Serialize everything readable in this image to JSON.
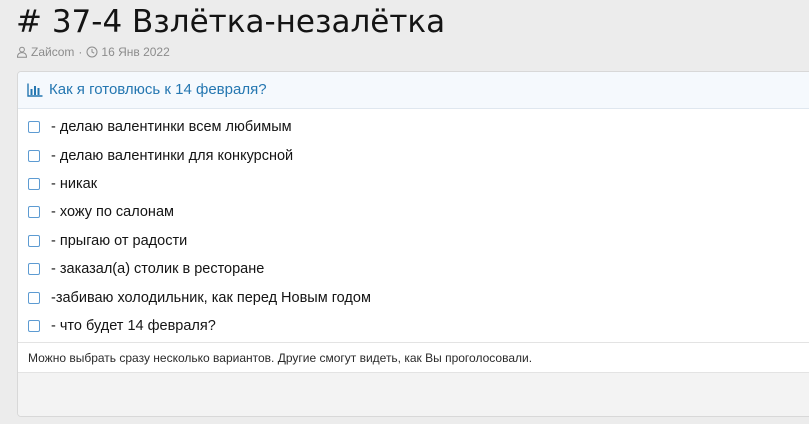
{
  "thread": {
    "title": "# 37-4 Взлётка-незалётка",
    "author": "Zaйcom",
    "date": "16 Янв 2022",
    "separator": "·",
    "icons": {
      "author": "user-icon",
      "date": "clock-icon"
    }
  },
  "poll": {
    "icon": "bar-chart-icon",
    "question": "Как я готовлюсь к 14 февраля?",
    "options": [
      {
        "label": "- делаю валентинки всем любимым",
        "checked": false
      },
      {
        "label": "- делаю валентинки для конкурсной",
        "checked": false
      },
      {
        "label": "- никак",
        "checked": false
      },
      {
        "label": "- хожу по салонам",
        "checked": false
      },
      {
        "label": "- прыгаю от радости",
        "checked": false
      },
      {
        "label": "- заказал(а) столик в ресторане",
        "checked": false
      },
      {
        "label": "-забиваю холодильник, как перед Новым годом",
        "checked": false
      },
      {
        "label": "- что будет 14 февраля?",
        "checked": false
      }
    ],
    "hint": "Можно выбрать сразу несколько вариантов. Другие смогут видеть, как Вы проголосовали."
  },
  "colors": {
    "accent": "#2577b1",
    "checkbox_border": "#5d9bd2",
    "header_bg": "#f5f9fd",
    "page_bg": "#ececec",
    "muted_text": "#8c8c8c"
  }
}
